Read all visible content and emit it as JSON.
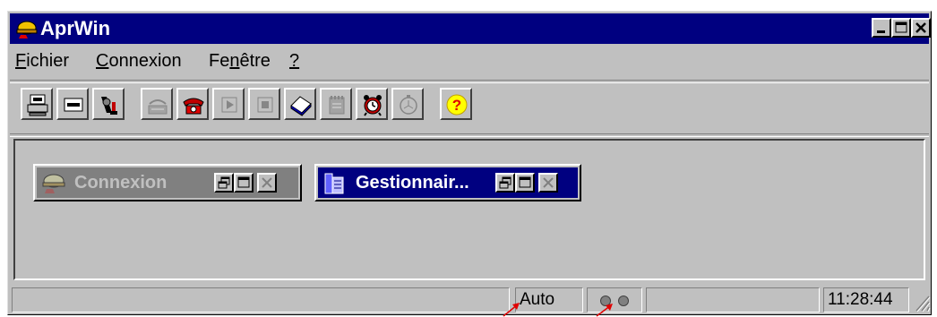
{
  "window": {
    "title": "AprWin",
    "title_icon": "helmet-icon"
  },
  "menu": {
    "fichier_accel": "F",
    "fichier_rest": "ichier",
    "connexion_accel": "C",
    "connexion_rest": "onnexion",
    "fenetre_pre": "Fe",
    "fenetre_accel": "n",
    "fenetre_rest": "être",
    "help_accel": "?"
  },
  "toolbar": {
    "buttons": [
      {
        "icon": "printer-computer-icon",
        "enabled": true
      },
      {
        "icon": "terminal-icon",
        "enabled": true
      },
      {
        "icon": "settings-tools-icon",
        "enabled": true
      },
      {
        "icon": "modem-icon",
        "enabled": false
      },
      {
        "icon": "telephone-icon",
        "enabled": true
      },
      {
        "icon": "play-icon",
        "enabled": false
      },
      {
        "icon": "stop-icon",
        "enabled": false
      },
      {
        "icon": "book-icon",
        "enabled": true
      },
      {
        "icon": "notepad-icon",
        "enabled": false
      },
      {
        "icon": "alarm-clock-icon",
        "enabled": true
      },
      {
        "icon": "stopwatch-icon",
        "enabled": false
      },
      {
        "icon": "help-icon",
        "enabled": true
      }
    ]
  },
  "mdi": {
    "connexion_title": "Connexion",
    "gestionnaire_title": "Gestionnair..."
  },
  "status": {
    "mode": "Auto",
    "time": "11:28:44"
  },
  "colors": {
    "face": "#c0c0c0",
    "active_title": "#000080",
    "inactive_title": "#808080",
    "annotation_arrow": "#e00000"
  }
}
